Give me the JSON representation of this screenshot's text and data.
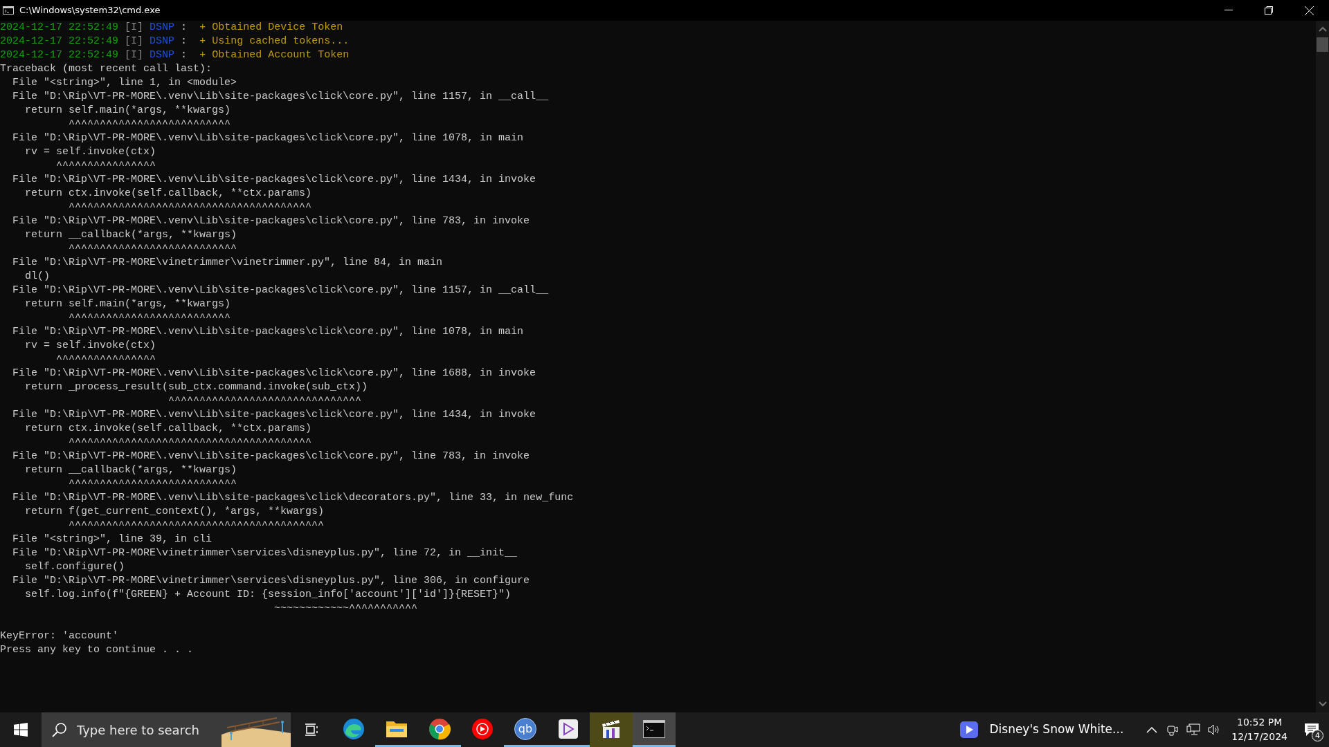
{
  "window": {
    "title": "C:\\Windows\\system32\\cmd.exe"
  },
  "console": {
    "lines": [
      {
        "kind": "log",
        "time": "2024-12-17 22:52:49",
        "level": "[I]",
        "source": "DSNP",
        "separator": ":",
        "message": "+ Obtained Device Token"
      },
      {
        "kind": "log",
        "time": "2024-12-17 22:52:49",
        "level": "[I]",
        "source": "DSNP",
        "separator": ":",
        "message": "+ Using cached tokens..."
      },
      {
        "kind": "log",
        "time": "2024-12-17 22:52:49",
        "level": "[I]",
        "source": "DSNP",
        "separator": ":",
        "message": "+ Obtained Account Token"
      },
      {
        "kind": "plain",
        "text": "Traceback (most recent call last):"
      },
      {
        "kind": "plain",
        "text": "  File \"<string>\", line 1, in <module>"
      },
      {
        "kind": "plain",
        "text": "  File \"D:\\Rip\\VT-PR-MORE\\.venv\\Lib\\site-packages\\click\\core.py\", line 1157, in __call__"
      },
      {
        "kind": "plain",
        "text": "    return self.main(*args, **kwargs)"
      },
      {
        "kind": "plain",
        "text": "           ^^^^^^^^^^^^^^^^^^^^^^^^^^"
      },
      {
        "kind": "plain",
        "text": "  File \"D:\\Rip\\VT-PR-MORE\\.venv\\Lib\\site-packages\\click\\core.py\", line 1078, in main"
      },
      {
        "kind": "plain",
        "text": "    rv = self.invoke(ctx)"
      },
      {
        "kind": "plain",
        "text": "         ^^^^^^^^^^^^^^^^"
      },
      {
        "kind": "plain",
        "text": "  File \"D:\\Rip\\VT-PR-MORE\\.venv\\Lib\\site-packages\\click\\core.py\", line 1434, in invoke"
      },
      {
        "kind": "plain",
        "text": "    return ctx.invoke(self.callback, **ctx.params)"
      },
      {
        "kind": "plain",
        "text": "           ^^^^^^^^^^^^^^^^^^^^^^^^^^^^^^^^^^^^^^^"
      },
      {
        "kind": "plain",
        "text": "  File \"D:\\Rip\\VT-PR-MORE\\.venv\\Lib\\site-packages\\click\\core.py\", line 783, in invoke"
      },
      {
        "kind": "plain",
        "text": "    return __callback(*args, **kwargs)"
      },
      {
        "kind": "plain",
        "text": "           ^^^^^^^^^^^^^^^^^^^^^^^^^^^"
      },
      {
        "kind": "plain",
        "text": "  File \"D:\\Rip\\VT-PR-MORE\\vinetrimmer\\vinetrimmer.py\", line 84, in main"
      },
      {
        "kind": "plain",
        "text": "    dl()"
      },
      {
        "kind": "plain",
        "text": "  File \"D:\\Rip\\VT-PR-MORE\\.venv\\Lib\\site-packages\\click\\core.py\", line 1157, in __call__"
      },
      {
        "kind": "plain",
        "text": "    return self.main(*args, **kwargs)"
      },
      {
        "kind": "plain",
        "text": "           ^^^^^^^^^^^^^^^^^^^^^^^^^^"
      },
      {
        "kind": "plain",
        "text": "  File \"D:\\Rip\\VT-PR-MORE\\.venv\\Lib\\site-packages\\click\\core.py\", line 1078, in main"
      },
      {
        "kind": "plain",
        "text": "    rv = self.invoke(ctx)"
      },
      {
        "kind": "plain",
        "text": "         ^^^^^^^^^^^^^^^^"
      },
      {
        "kind": "plain",
        "text": "  File \"D:\\Rip\\VT-PR-MORE\\.venv\\Lib\\site-packages\\click\\core.py\", line 1688, in invoke"
      },
      {
        "kind": "plain",
        "text": "    return _process_result(sub_ctx.command.invoke(sub_ctx))"
      },
      {
        "kind": "plain",
        "text": "                           ^^^^^^^^^^^^^^^^^^^^^^^^^^^^^^^"
      },
      {
        "kind": "plain",
        "text": "  File \"D:\\Rip\\VT-PR-MORE\\.venv\\Lib\\site-packages\\click\\core.py\", line 1434, in invoke"
      },
      {
        "kind": "plain",
        "text": "    return ctx.invoke(self.callback, **ctx.params)"
      },
      {
        "kind": "plain",
        "text": "           ^^^^^^^^^^^^^^^^^^^^^^^^^^^^^^^^^^^^^^^"
      },
      {
        "kind": "plain",
        "text": "  File \"D:\\Rip\\VT-PR-MORE\\.venv\\Lib\\site-packages\\click\\core.py\", line 783, in invoke"
      },
      {
        "kind": "plain",
        "text": "    return __callback(*args, **kwargs)"
      },
      {
        "kind": "plain",
        "text": "           ^^^^^^^^^^^^^^^^^^^^^^^^^^^"
      },
      {
        "kind": "plain",
        "text": "  File \"D:\\Rip\\VT-PR-MORE\\.venv\\Lib\\site-packages\\click\\decorators.py\", line 33, in new_func"
      },
      {
        "kind": "plain",
        "text": "    return f(get_current_context(), *args, **kwargs)"
      },
      {
        "kind": "plain",
        "text": "           ^^^^^^^^^^^^^^^^^^^^^^^^^^^^^^^^^^^^^^^^^"
      },
      {
        "kind": "plain",
        "text": "  File \"<string>\", line 39, in cli"
      },
      {
        "kind": "plain",
        "text": "  File \"D:\\Rip\\VT-PR-MORE\\vinetrimmer\\services\\disneyplus.py\", line 72, in __init__"
      },
      {
        "kind": "plain",
        "text": "    self.configure()"
      },
      {
        "kind": "plain",
        "text": "  File \"D:\\Rip\\VT-PR-MORE\\vinetrimmer\\services\\disneyplus.py\", line 306, in configure"
      },
      {
        "kind": "plain",
        "text": "    self.log.info(f\"{GREEN} + Account ID: {session_info['account']['id']}{RESET}\")"
      },
      {
        "kind": "plain",
        "text": "                                            ~~~~~~~~~~~~^^^^^^^^^^^"
      },
      {
        "kind": "blank"
      },
      {
        "kind": "plain",
        "text": "KeyError: 'account'"
      },
      {
        "kind": "plain",
        "text": "Press any key to continue . . ."
      }
    ]
  },
  "taskbar": {
    "search": {
      "placeholder": "Type here to search"
    },
    "apps": [
      {
        "kind": "edge",
        "running": false,
        "active": false,
        "attention": false
      },
      {
        "kind": "explorer",
        "running": true,
        "active": false,
        "attention": false
      },
      {
        "kind": "chrome",
        "running": true,
        "active": false,
        "attention": false
      },
      {
        "kind": "youtube",
        "running": false,
        "active": false,
        "attention": false
      },
      {
        "kind": "qbittorrent",
        "label": "qb",
        "running": true,
        "active": false,
        "attention": false
      },
      {
        "kind": "video-app",
        "running": true,
        "active": false,
        "attention": false
      },
      {
        "kind": "clapper",
        "running": false,
        "active": false,
        "attention": true
      },
      {
        "kind": "terminal",
        "running": true,
        "active": true,
        "attention": false
      }
    ],
    "media": {
      "title": "Disney's Snow White..."
    },
    "clock": {
      "time": "10:52 PM",
      "date": "12/17/2024"
    },
    "notifications": {
      "count": "4"
    }
  }
}
